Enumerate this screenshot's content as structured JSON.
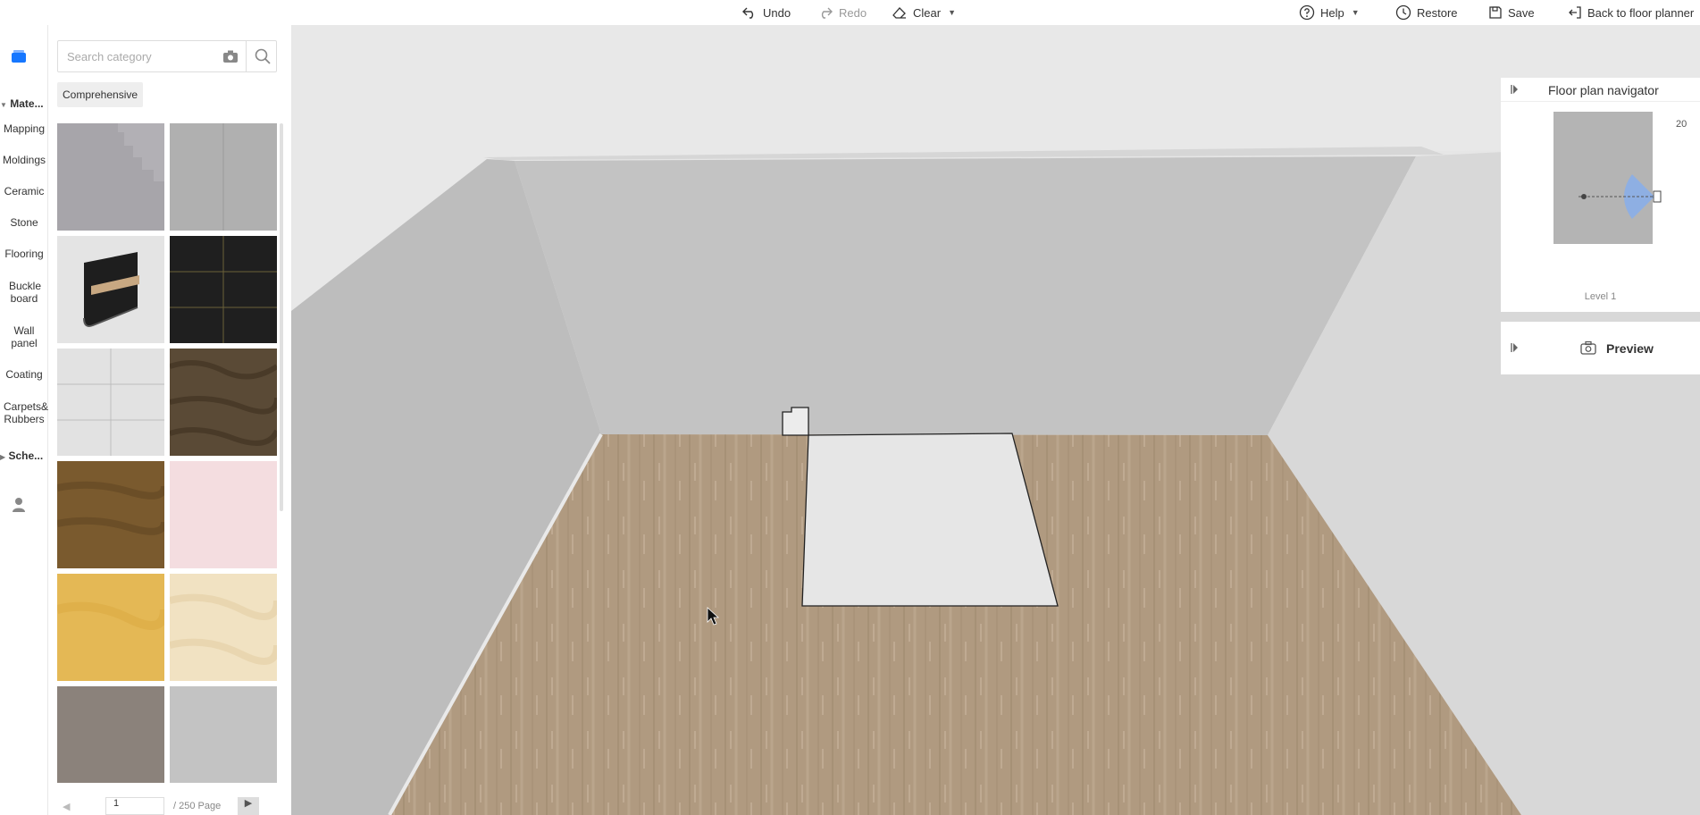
{
  "topbar": {
    "undo": "Undo",
    "redo": "Redo",
    "clear": "Clear",
    "help": "Help",
    "restore": "Restore",
    "save": "Save",
    "back": "Back to floor planner"
  },
  "rail": {
    "section_materials": "Mate...",
    "items": [
      "Mapping",
      "Moldings",
      "Ceramic",
      "Stone",
      "Flooring",
      "Buckle board",
      "Wall panel",
      "Coating",
      "Carpets& Rubbers"
    ],
    "section_schemes": "Sche..."
  },
  "panel": {
    "search_placeholder": "Search category",
    "chip": "Comprehensive",
    "page_value": "1",
    "page_total": "/ 250 Page"
  },
  "navigator": {
    "title": "Floor plan navigator",
    "level": "Level 1",
    "zoom": "20"
  },
  "preview": {
    "title": "Preview"
  },
  "colors": {
    "floor": "#b09a80",
    "wall": "#c0c0c0",
    "accent": "#1677ff",
    "cone": "#8aaee8"
  }
}
